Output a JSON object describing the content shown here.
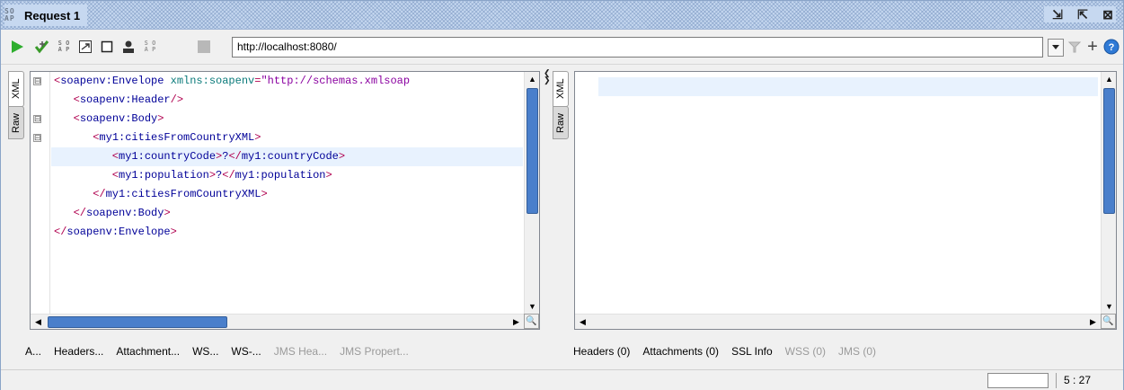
{
  "window": {
    "logo": "SO\nAP",
    "title": "Request 1"
  },
  "title_controls": [
    {
      "icon": "undock-icon",
      "glyph": "⇲"
    },
    {
      "icon": "maximize-icon",
      "glyph": "⇱"
    },
    {
      "icon": "close-icon",
      "glyph": "⊠"
    }
  ],
  "toolbar": {
    "url": "http://localhost:8080/",
    "icons": [
      "run-icon",
      "add-assertion-icon",
      "create-request-icon",
      "source-icon",
      "stop-square-icon",
      "user-icon",
      "soap-icon",
      "cancel-icon"
    ]
  },
  "request": {
    "tabs": [
      "XML",
      "Raw"
    ],
    "lines": [
      [
        {
          "c": "tg",
          "t": "<"
        },
        {
          "c": "nm",
          "t": "soapenv:Envelope"
        },
        {
          "c": "at",
          "t": " xmlns:soapenv"
        },
        {
          "c": "tg",
          "t": "="
        },
        {
          "c": "st",
          "t": "\"http://schemas.xmlsoap"
        }
      ],
      [
        {
          "c": "tg",
          "t": "   <"
        },
        {
          "c": "nm",
          "t": "soapenv:Header"
        },
        {
          "c": "tg",
          "t": "/>"
        }
      ],
      [
        {
          "c": "tg",
          "t": "   <"
        },
        {
          "c": "nm",
          "t": "soapenv:Body"
        },
        {
          "c": "tg",
          "t": ">"
        }
      ],
      [
        {
          "c": "tg",
          "t": "      <"
        },
        {
          "c": "nm",
          "t": "my1:citiesFromCountryXML"
        },
        {
          "c": "tg",
          "t": ">"
        }
      ],
      [
        {
          "c": "tg",
          "t": "         <"
        },
        {
          "c": "nm",
          "t": "my1:countryCode"
        },
        {
          "c": "tg",
          "t": ">"
        },
        {
          "c": "nm",
          "t": "?"
        },
        {
          "c": "tg",
          "t": "</"
        },
        {
          "c": "nm",
          "t": "my1:countryCode"
        },
        {
          "c": "tg",
          "t": ">"
        }
      ],
      [
        {
          "c": "tg",
          "t": "         <"
        },
        {
          "c": "nm",
          "t": "my1:population"
        },
        {
          "c": "tg",
          "t": ">"
        },
        {
          "c": "nm",
          "t": "?"
        },
        {
          "c": "tg",
          "t": "</"
        },
        {
          "c": "nm",
          "t": "my1:population"
        },
        {
          "c": "tg",
          "t": ">"
        }
      ],
      [
        {
          "c": "tg",
          "t": "      </"
        },
        {
          "c": "nm",
          "t": "my1:citiesFromCountryXML"
        },
        {
          "c": "tg",
          "t": ">"
        }
      ],
      [
        {
          "c": "tg",
          "t": "   </"
        },
        {
          "c": "nm",
          "t": "soapenv:Body"
        },
        {
          "c": "tg",
          "t": ">"
        }
      ],
      [
        {
          "c": "tg",
          "t": "</"
        },
        {
          "c": "nm",
          "t": "soapenv:Envelope"
        },
        {
          "c": "tg",
          "t": ">"
        }
      ]
    ],
    "highlighted_line": 4,
    "fold_markers": [
      "⊟",
      "",
      "⊟",
      "⊟"
    ],
    "bottom_tabs": [
      {
        "label": "A...",
        "enabled": true
      },
      {
        "label": "Headers...",
        "enabled": true
      },
      {
        "label": "Attachment...",
        "enabled": true
      },
      {
        "label": "WS...",
        "enabled": true
      },
      {
        "label": "WS-...",
        "enabled": true
      },
      {
        "label": "JMS Hea...",
        "enabled": false
      },
      {
        "label": "JMS Propert...",
        "enabled": false
      }
    ]
  },
  "response": {
    "tabs": [
      "XML",
      "Raw"
    ],
    "bottom_tabs": [
      {
        "label": "Headers (0)",
        "enabled": true
      },
      {
        "label": "Attachments (0)",
        "enabled": true
      },
      {
        "label": "SSL Info",
        "enabled": true
      },
      {
        "label": "WSS (0)",
        "enabled": false
      },
      {
        "label": "JMS (0)",
        "enabled": false
      }
    ]
  },
  "statusbar": {
    "position": "5 : 27"
  },
  "colors": {
    "accent": "#4a7fcb",
    "run_green": "#2eae2e"
  }
}
